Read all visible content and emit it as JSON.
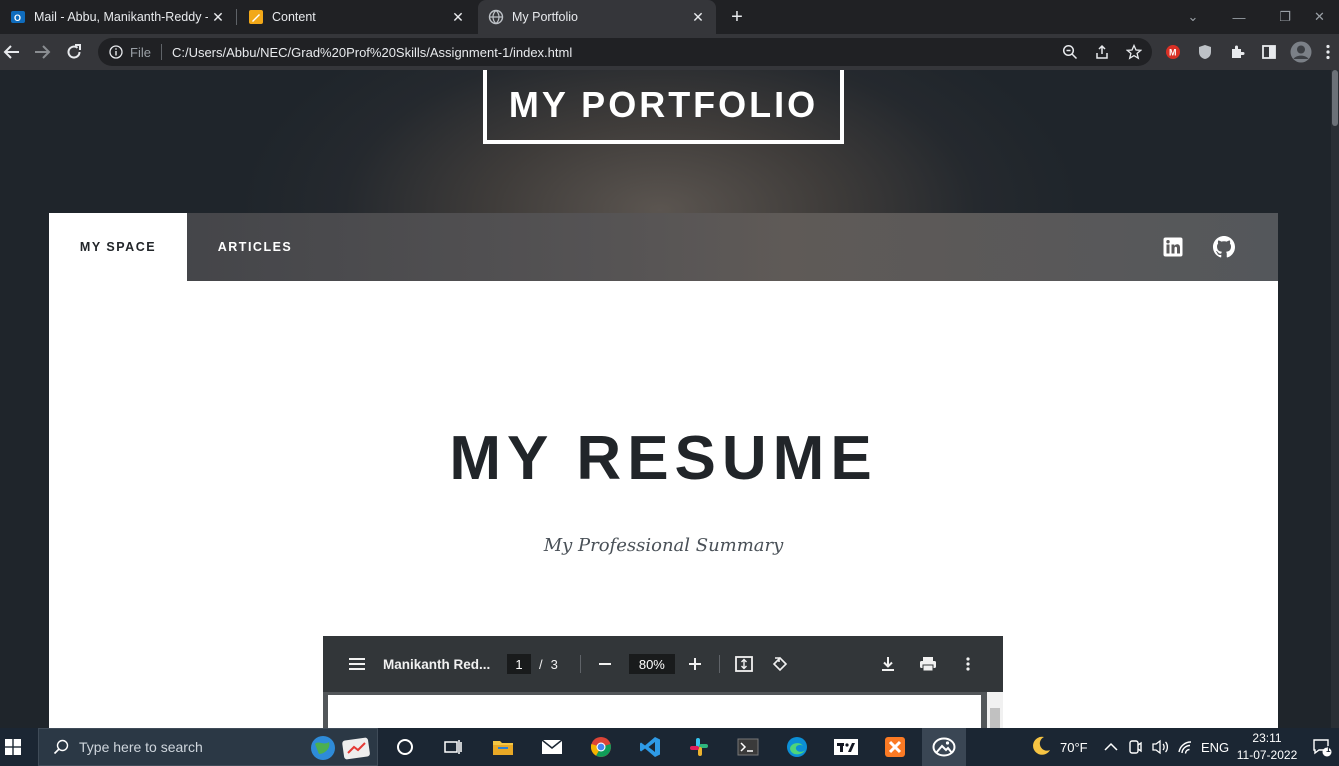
{
  "browser": {
    "tabs": [
      {
        "title": "Mail - Abbu, Manikanth-Reddy -",
        "icon": "outlook-icon",
        "active": false
      },
      {
        "title": "Content",
        "icon": "document-edit-icon",
        "active": false
      },
      {
        "title": "My Portfolio",
        "icon": "globe-icon",
        "active": true
      }
    ],
    "omnibox": {
      "scheme_label": "File",
      "url": "C:/Users/Abbu/NEC/Grad%20Prof%20Skills/Assignment-1/index.html"
    }
  },
  "page": {
    "brand": "MY PORTFOLIO",
    "nav": {
      "items": [
        {
          "label": "MY SPACE",
          "active": true
        },
        {
          "label": "ARTICLES",
          "active": false
        }
      ]
    },
    "social": [
      "linkedin-icon",
      "github-icon"
    ],
    "resume_title": "MY RESUME",
    "resume_subtitle": "My Professional Summary"
  },
  "pdf_viewer": {
    "document_title": "Manikanth Red...",
    "current_page": "1",
    "page_separator": "/",
    "total_pages": "3",
    "zoom": "80%"
  },
  "taskbar": {
    "search_placeholder": "Type here to search",
    "weather": "70°F",
    "language": "ENG",
    "time": "23:11",
    "date": "11-07-2022",
    "notification_count": "1"
  },
  "colors": {
    "accent": "#212529",
    "browser_bg": "#202124",
    "taskbar_bg": "#1b2633"
  }
}
